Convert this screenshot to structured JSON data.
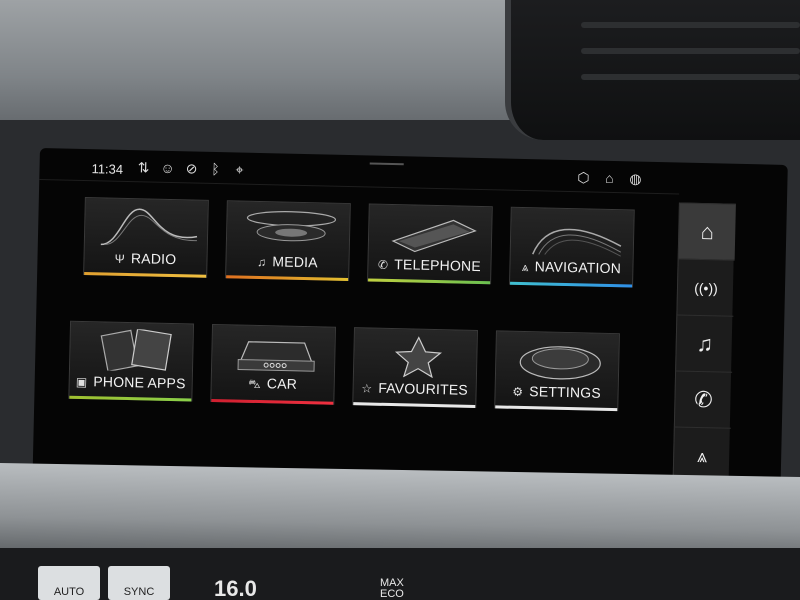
{
  "status_bar": {
    "time": "11:34",
    "left_icons": [
      "data-icon",
      "person-icon",
      "mute-icon",
      "bluetooth-icon",
      "location-pin-icon"
    ],
    "right_icons": [
      "package-icon",
      "connect-icon",
      "globe-icon"
    ]
  },
  "tiles": [
    {
      "id": "radio",
      "label": "RADIO",
      "icon": "antenna-icon",
      "glyph": "📡",
      "accent": "#e0a030"
    },
    {
      "id": "media",
      "label": "MEDIA",
      "icon": "music-note-icon",
      "glyph": "♫",
      "accent": "#e3a321"
    },
    {
      "id": "telephone",
      "label": "TELEPHONE",
      "icon": "phone-icon",
      "glyph": "✆",
      "accent": "#8ad04a"
    },
    {
      "id": "navigation",
      "label": "NAVIGATION",
      "icon": "navigation-arrow-icon",
      "glyph": "▲",
      "accent": "#35a6e8"
    },
    {
      "id": "phone-apps",
      "label": "PHONE APPS",
      "icon": "phone-apps-icon",
      "glyph": "▣",
      "accent": "#9acb3c"
    },
    {
      "id": "car",
      "label": "CAR",
      "icon": "car-icon",
      "glyph": "⛍",
      "accent": "#e0303a"
    },
    {
      "id": "favourites",
      "label": "FAVOURITES",
      "icon": "star-icon",
      "glyph": "☆",
      "accent": "#ffffff"
    },
    {
      "id": "settings",
      "label": "SETTINGS",
      "icon": "gear-icon",
      "glyph": "⚙",
      "accent": "#ffffff"
    }
  ],
  "sidebar": {
    "items": [
      {
        "icon": "home-icon",
        "glyph": "⌂",
        "active": true
      },
      {
        "icon": "radio-icon",
        "glyph": "((•))",
        "active": false
      },
      {
        "icon": "music-note-icon",
        "glyph": "♫",
        "active": false
      },
      {
        "icon": "phone-icon",
        "glyph": "✆",
        "active": false
      },
      {
        "icon": "navigation-arrow-icon",
        "glyph": "▲",
        "active": false
      }
    ]
  },
  "climate": {
    "buttons": [
      "AUTO",
      "SYNC"
    ],
    "temperature": "16.0",
    "max_eco": [
      "MAX",
      "ECO"
    ]
  }
}
